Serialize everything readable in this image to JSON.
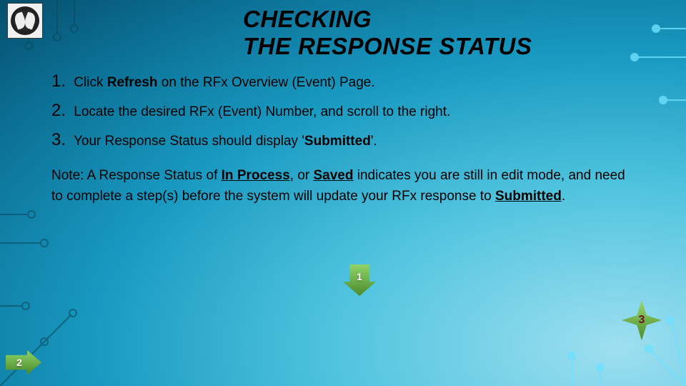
{
  "title_line1": "CHECKING",
  "title_line2": "THE RESPONSE STATUS",
  "steps": [
    {
      "num": "1.",
      "pre": "Click ",
      "bold": "Refresh",
      "post": " on the RFx Overview (Event) Page."
    },
    {
      "num": "2.",
      "pre": "Locate the desired RFx (Event) Number, and scroll to the right.",
      "bold": "",
      "post": ""
    },
    {
      "num": "3.",
      "pre": "Your Response Status should display '",
      "bold": "Submitted",
      "post": "'."
    }
  ],
  "note": {
    "t1": "Note: A Response Status of ",
    "b1": "In Process",
    "t2": ", or ",
    "b2": "Saved",
    "t3": " indicates you are still in edit mode, and need to complete a step(s) before the system will update your RFx response to ",
    "b3": "Submitted",
    "t4": "."
  },
  "callouts": {
    "one": "1",
    "two": "2",
    "three": "3"
  }
}
